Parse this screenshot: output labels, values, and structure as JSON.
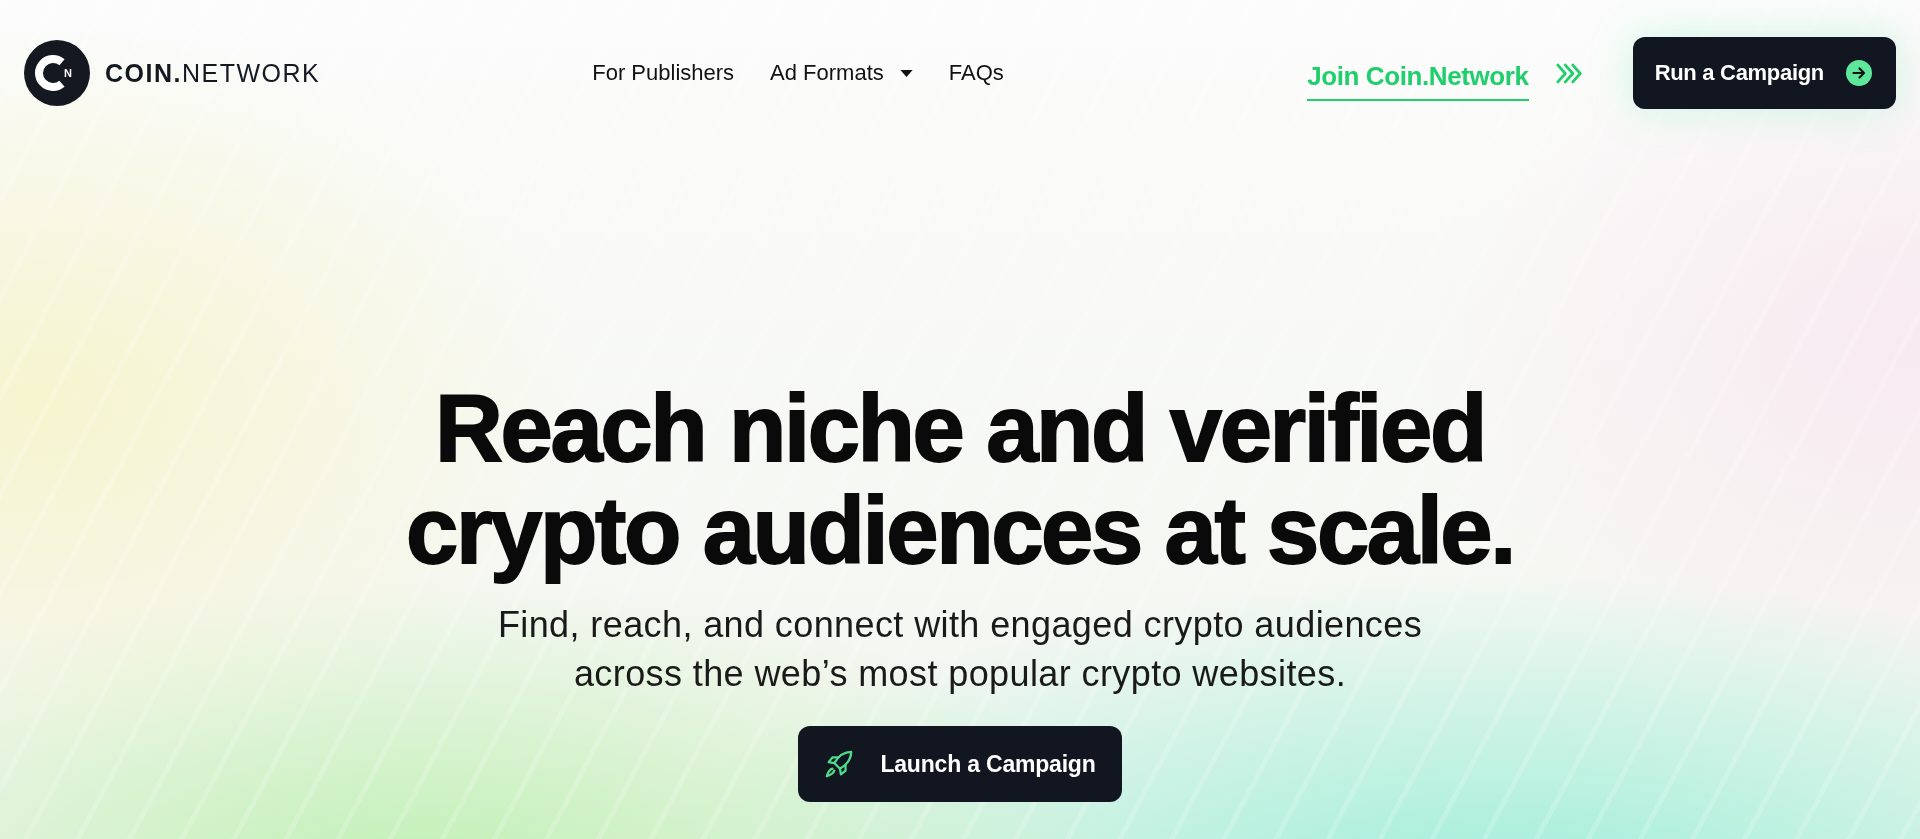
{
  "header": {
    "logo": {
      "monogram": "N",
      "wordmark": "**COIN.**NETWORK"
    },
    "nav": [
      {
        "label": "For Publishers",
        "has_dropdown": false
      },
      {
        "label": "Ad Formats",
        "has_dropdown": true
      },
      {
        "label": "FAQs",
        "has_dropdown": false
      }
    ],
    "join_link": "Join Coin.Network",
    "cta": "Run a Campaign"
  },
  "hero": {
    "headline": "Reach niche and verified crypto audiences at scale.",
    "subtitle": "Find, reach, and connect with engaged crypto audiences across the web’s most popular crypto websites.",
    "button": "Launch a Campaign"
  }
}
